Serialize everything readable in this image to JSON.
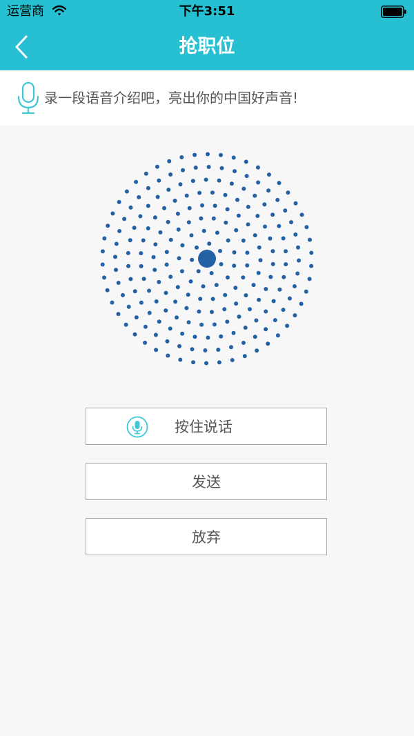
{
  "status_bar": {
    "carrier": "运营商",
    "time": "下午3:51",
    "wifi_icon": "wifi-icon",
    "battery_icon": "battery-icon"
  },
  "nav": {
    "title": "抢职位",
    "back_icon": "chevron-left-icon"
  },
  "prompt": {
    "icon": "microphone-icon",
    "text": "录一段语音介绍吧，亮出你的中国好声音!"
  },
  "visualizer": {
    "icon": "voice-dots-visualizer",
    "dot_color": "#2460a4"
  },
  "buttons": {
    "hold_to_talk": "按住说话",
    "hold_to_talk_icon": "microphone-circle-icon",
    "send": "发送",
    "discard": "放弃"
  },
  "colors": {
    "accent": "#27c0d2",
    "background": "#f7f7f7",
    "dot": "#2460a4"
  }
}
